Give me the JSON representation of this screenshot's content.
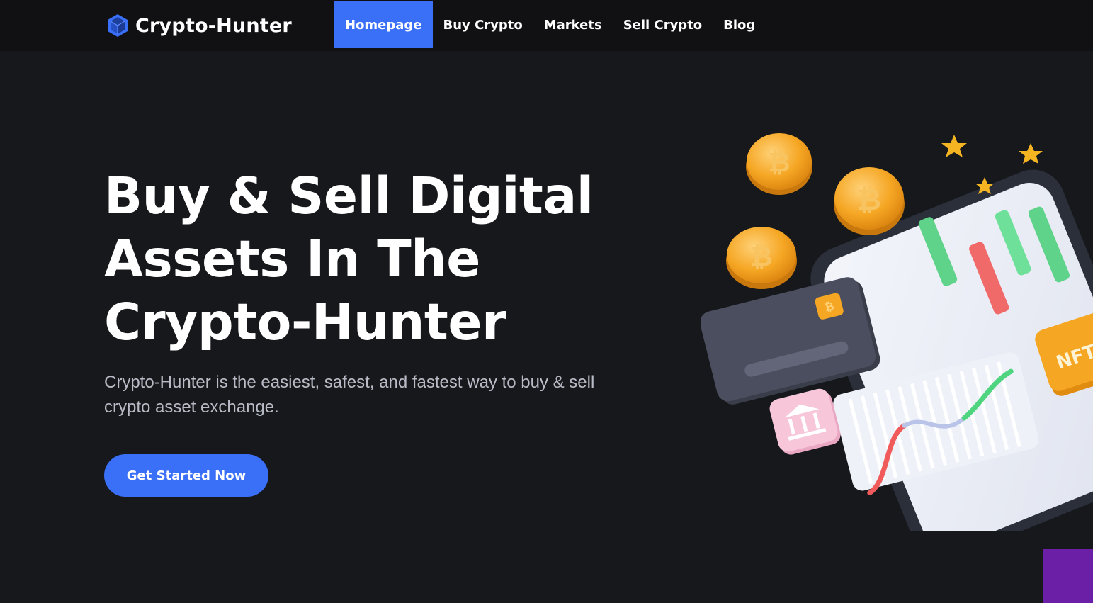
{
  "brand": {
    "name": "Crypto-Hunter",
    "icon": "cube-icon"
  },
  "nav": {
    "items": [
      {
        "label": "Homepage",
        "active": true
      },
      {
        "label": "Buy Crypto",
        "active": false
      },
      {
        "label": "Markets",
        "active": false
      },
      {
        "label": "Sell Crypto",
        "active": false
      },
      {
        "label": "Blog",
        "active": false
      }
    ]
  },
  "hero": {
    "title_lines": [
      "Buy & Sell Digital",
      "Assets In The",
      "Crypto-Hunter"
    ],
    "description": "Crypto-Hunter is the easiest, safest, and fastest way to buy & sell crypto asset exchange.",
    "cta_label": "Get Started Now"
  },
  "illustration": {
    "coin_symbol": "₿",
    "nft_label": "NFT"
  },
  "colors": {
    "accent": "#3a6ff8",
    "background": "#17181c",
    "navbar": "#111113",
    "corner": "#6a1fa6"
  }
}
